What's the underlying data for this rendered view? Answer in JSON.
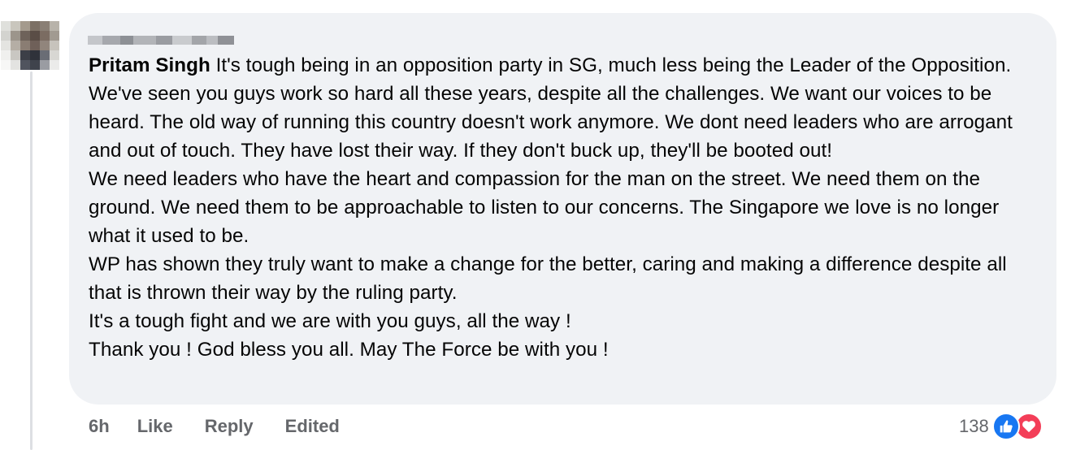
{
  "comment": {
    "author_mention": "Pritam Singh",
    "intro": "It's tough being in an opposition party in SG, much less being the Leader of the Opposition. We've seen you guys work so hard all these years, despite all the challenges. We want our voices to be heard. The old way of running this country doesn't work anymore. We dont need leaders who are arrogant and out of touch. They have lost their way. If they don't buck up, they'll be booted out!",
    "paragraphs": [
      "We need leaders who have the heart and compassion for the man on the street. We need them on the ground. We need them to be approachable to listen to our concerns. The Singapore we love is no longer what it used to be.",
      "WP has shown they truly want to make a change for the better, caring and making a difference despite all that is thrown their way by the ruling party.",
      "It's a tough fight and we are with you guys, all the way !",
      "Thank you ! God bless you all. May The Force be with you !"
    ]
  },
  "actions": {
    "time": "6h",
    "like": "Like",
    "reply": "Reply",
    "edited": "Edited"
  },
  "reactions": {
    "count": "138",
    "icons": [
      "thumbs-up",
      "heart"
    ],
    "colors": {
      "like": "#1877f2",
      "love": "#f33e58"
    }
  },
  "colors": {
    "bubble": "#f0f2f5",
    "text": "#050505",
    "secondary": "#65676b"
  }
}
